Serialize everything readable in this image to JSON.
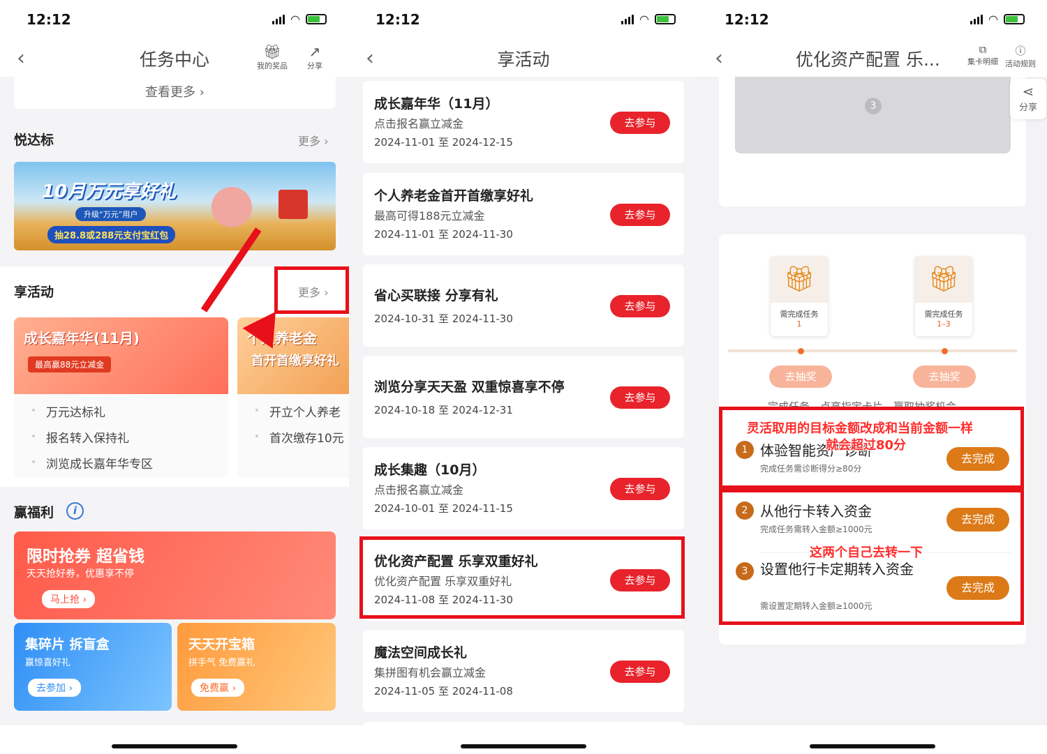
{
  "status": {
    "time": "12:12"
  },
  "p1": {
    "title": "任务中心",
    "prize": "我的奖品",
    "share": "分享",
    "view_more": "查看更多",
    "s1_title": "悦达标",
    "s1_more": "更多",
    "banner_head": "10月万元享好礼",
    "banner_sub": "升级“万元”用户",
    "banner_foot": "抽28.8或288元支付宝红包",
    "s2_title": "享活动",
    "s2_more": "更多",
    "act1": {
      "head": "成长嘉年华(11月)",
      "sub": "最高赢88元立减金",
      "items": [
        "万元达标礼",
        "报名转入保持礼",
        "浏览成长嘉年华专区"
      ]
    },
    "act2": {
      "head": "个人养老金",
      "sub": "首开首缴享好礼",
      "items": [
        "开立个人养老",
        "首次缴存10元"
      ]
    },
    "s3_title": "赢福利",
    "big": {
      "head": "限时抢券 超省钱",
      "sub": "天天抢好券，优惠享不停",
      "btn": "马上抢"
    },
    "b2": {
      "head": "集碎片 拆盲盒",
      "sub": "赢惊喜好礼",
      "btn": "去参加"
    },
    "b3": {
      "head": "天天开宝箱",
      "sub": "拼手气 免费赢礼",
      "btn": "免费赢"
    }
  },
  "p2": {
    "title": "享活动",
    "join": "去参与",
    "events": [
      {
        "title": "成长嘉年华（11月）",
        "sub": "点击报名赢立减金",
        "date": "2024-11-01 至 2024-12-15"
      },
      {
        "title": "个人养老金首开首缴享好礼",
        "sub": "最高可得188元立减金",
        "date": "2024-11-01 至 2024-11-30"
      },
      {
        "title": "省心买联接 分享有礼",
        "sub": "",
        "date": "2024-10-31 至 2024-11-30"
      },
      {
        "title": "浏览分享天天盈 双重惊喜享不停",
        "sub": "",
        "date": "2024-10-18 至 2024-12-31"
      },
      {
        "title": "成长集趣（10月）",
        "sub": "点击报名赢立减金",
        "date": "2024-10-01 至 2024-11-15"
      },
      {
        "title": "优化资产配置 乐享双重好礼",
        "sub": "优化资产配置 乐享双重好礼",
        "date": "2024-11-08 至 2024-11-30"
      },
      {
        "title": "魔法空间成长礼",
        "sub": "集拼图有机会赢立减金",
        "date": "2024-11-05 至 2024-11-08"
      }
    ]
  },
  "p3": {
    "title": "优化资产配置 乐...",
    "cards": "集卡明细",
    "rules": "活动规则",
    "share": "分享",
    "gray_num": "3",
    "gift1": {
      "label": "需完成任务",
      "num": "1"
    },
    "gift2": {
      "label": "需完成任务",
      "num": "1–3"
    },
    "draw": "去抽奖",
    "hint": "完成任务，点亮指定卡片，赢取抽奖机会",
    "tasks": [
      {
        "n": "1",
        "name": "体验智能资产诊断",
        "desc": "完成任务需诊断得分≥80分",
        "btn": "去完成"
      },
      {
        "n": "2",
        "name": "从他行卡转入资金",
        "desc": "完成任务需转入金额≥1000元",
        "btn": "去完成"
      },
      {
        "n": "3",
        "name": "设置他行卡定期转入资金",
        "desc": "需设置定期转入金额≥1000元",
        "btn": "去完成"
      }
    ],
    "annot1": "灵活取用的目标金额改成和当前金额一样",
    "annot2": "就会超过80分",
    "annot3": "这两个自己去转一下"
  }
}
